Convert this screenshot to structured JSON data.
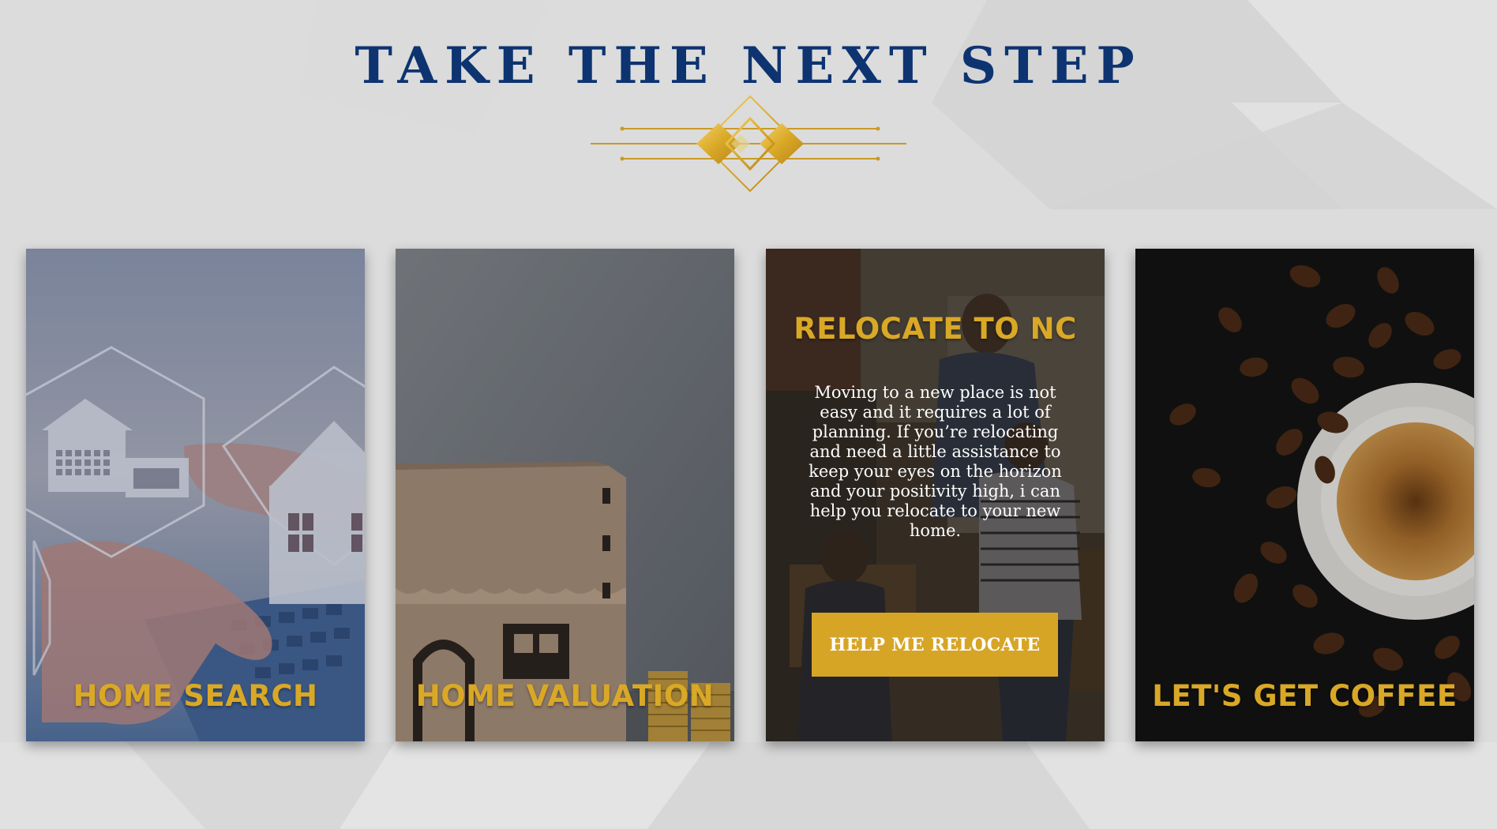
{
  "section": {
    "title": "TAKE THE NEXT STEP"
  },
  "cards": [
    {
      "title": "HOME SEARCH",
      "image": "laptop-house-icons-photo"
    },
    {
      "title": "HOME VALUATION",
      "image": "model-house-coins-photo"
    },
    {
      "title": "RELOCATE TO NC",
      "image": "moving-family-photo",
      "text": "Moving to a new place is not easy and it requires a lot of planning. If you’re relocating and need a little assistance to keep your eyes on the horizon and your positivity high, i can help you relocate to your new home.",
      "button_label": "HELP ME RELOCATE"
    },
    {
      "title": "LET'S GET COFFEE",
      "image": "coffee-cup-beans-photo"
    }
  ],
  "colors": {
    "title_navy": "#0d3471",
    "gold": "#d9a826",
    "background": "#dcdcdc"
  }
}
